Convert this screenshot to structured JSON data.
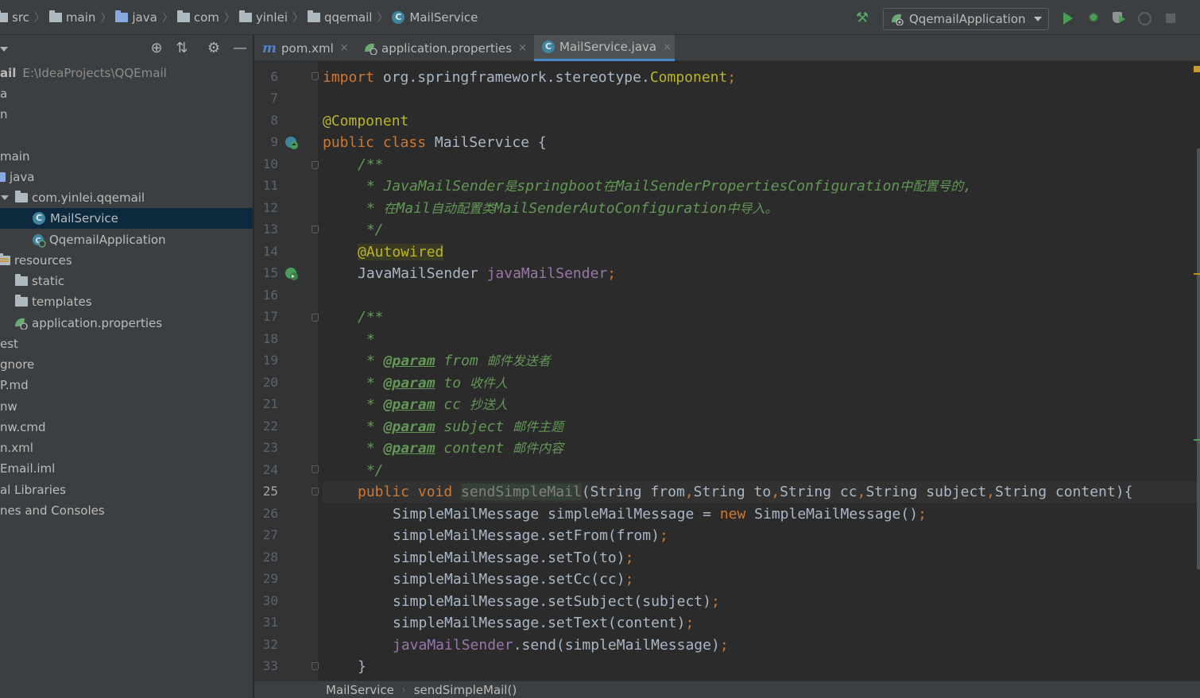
{
  "breadcrumb": [
    "src",
    "main",
    "java",
    "com",
    "yinlei",
    "qqemail",
    "MailService"
  ],
  "toolbar": {
    "run_config": "QqemailApplication",
    "icons": [
      "hammer-icon",
      "run-icon",
      "debug-icon",
      "coverage-icon",
      "profile-icon",
      "stop-icon"
    ]
  },
  "project": {
    "root_name": "ail",
    "root_path": "E:\\IdeaProjects\\QQEmail",
    "items": [
      {
        "label": "a"
      },
      {
        "label": "n"
      },
      {
        "label": "main"
      },
      {
        "label": "java"
      },
      {
        "label": "com.yinlei.qqemail"
      },
      {
        "label": "MailService",
        "selected": true
      },
      {
        "label": "QqemailApplication"
      },
      {
        "label": "resources"
      },
      {
        "label": "static"
      },
      {
        "label": "templates"
      },
      {
        "label": "application.properties"
      },
      {
        "label": "est"
      },
      {
        "label": "gnore"
      },
      {
        "label": "P.md"
      },
      {
        "label": "nw"
      },
      {
        "label": "nw.cmd"
      },
      {
        "label": "n.xml"
      },
      {
        "label": "Email.iml"
      },
      {
        "label": "al Libraries"
      },
      {
        "label": "nes and Consoles"
      }
    ]
  },
  "tabs": [
    {
      "label": "pom.xml",
      "close": "×"
    },
    {
      "label": "application.properties",
      "close": "×"
    },
    {
      "label": "MailService.java",
      "close": "×",
      "active": true
    }
  ],
  "editor": {
    "current_line": 25,
    "line_numbers": [
      6,
      7,
      8,
      9,
      10,
      11,
      12,
      13,
      14,
      15,
      16,
      17,
      18,
      19,
      20,
      21,
      22,
      23,
      24,
      25,
      26,
      27,
      28,
      29,
      30,
      31,
      32,
      33
    ],
    "code": {
      "l6_kw": "import",
      "l6_pkg": " org.springframework.stereotype.",
      "l6_cls": "Component",
      "l6_semi": ";",
      "l8": "@Component",
      "l9_kw": "public class",
      "l9_rest": " MailService {",
      "l10": "/**",
      "l11_a": " * JavaMailSender",
      "l11_b": "是",
      "l11_c": "springboot",
      "l11_d": "在",
      "l11_e": "MailSenderPropertiesConfiguration",
      "l11_f": "中配置号的",
      "l11_g": ",",
      "l12_a": " * ",
      "l12_b": "在",
      "l12_c": "Mail",
      "l12_d": "自动配置类",
      "l12_e": "MailSenderAutoConfiguration",
      "l12_f": "中导入。",
      "l13": " */",
      "l14": "@Autowired",
      "l15_type": "JavaMailSender ",
      "l15_field": "javaMailSender",
      "l15_semi": ";",
      "l17": "/**",
      "l18": " *",
      "params": [
        {
          "name": "from",
          "desc": "邮件发送者"
        },
        {
          "name": "to",
          "desc": "收件人"
        },
        {
          "name": "cc",
          "desc": "抄送人"
        },
        {
          "name": "subject",
          "desc": "邮件主题"
        },
        {
          "name": "content",
          "desc": "邮件内容"
        }
      ],
      "param_tag": "@param",
      "param_star": " * ",
      "l24": " */",
      "l25_kw": "public void ",
      "l25_method": "sendSimpleMail",
      "l25_open": "(",
      "l25_p1": "String from",
      "l25_p2": "String to",
      "l25_p3": "String cc",
      "l25_p4": "String subject",
      "l25_p5": "String content){",
      "comma": ",",
      "l26_a": "SimpleMailMessage simpleMailMessage = ",
      "l26_new": "new",
      "l26_b": " SimpleMailMessage()",
      "l27": "simpleMailMessage.setFrom(from)",
      "l28": "simpleMailMessage.setTo(to)",
      "l29": "simpleMailMessage.setCc(cc)",
      "l30": "simpleMailMessage.setSubject(subject)",
      "l31": "simpleMailMessage.setText(content)",
      "l32_field": "javaMailSender",
      "l32_rest": ".send(simpleMailMessage)",
      "semi": ";",
      "l33": "}"
    }
  },
  "footer": {
    "crumb1": "MailService",
    "crumb2": "sendSimpleMail()"
  },
  "colors": {
    "background": "#2b2b2b",
    "panel": "#3c3f41",
    "keyword": "#cc7832",
    "annotation": "#bbb529",
    "doc_comment": "#629755",
    "field": "#9876aa",
    "selection": "#0d293e",
    "accent": "#4a88c7"
  }
}
